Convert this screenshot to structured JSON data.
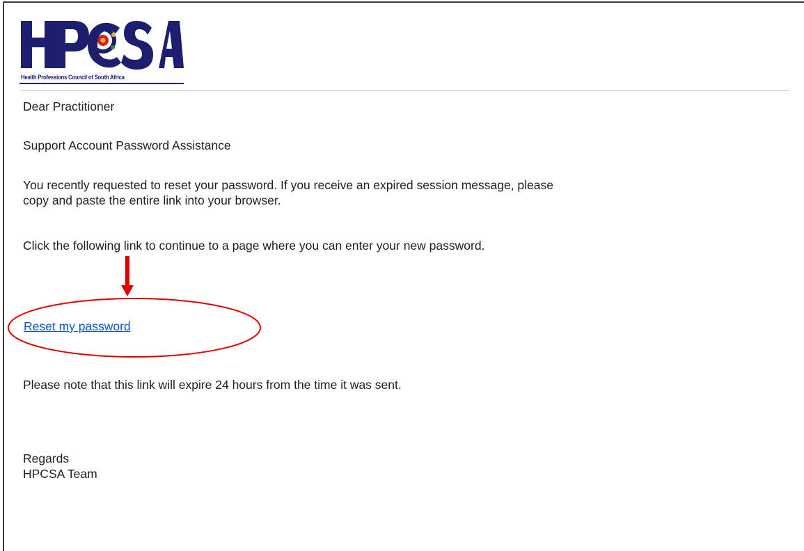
{
  "logo": {
    "name": "HPCSA",
    "tagline": "Health Professions Council of South Africa",
    "brand_color": "#1b1f6e"
  },
  "email": {
    "greeting": "Dear Practitioner",
    "subject_line": "Support Account Password Assistance",
    "paragraph_1_line_1": "You recently requested to reset your password. If you receive an expired session message, please",
    "paragraph_1_line_2": "copy and paste the entire link into your browser.",
    "paragraph_2": "Click the following link to continue to a page where you can enter your new password.",
    "reset_link_label": "Reset my password",
    "expiry_note": "Please note that this link will expire 24 hours from the time it was sent.",
    "signoff": "Regards",
    "signature": "HPCSA Team"
  },
  "annotation": {
    "arrow": "down-arrow",
    "highlight": "ellipse",
    "color": "#e00000"
  },
  "colors": {
    "link": "#1155cc",
    "text": "#1f1f1f"
  }
}
